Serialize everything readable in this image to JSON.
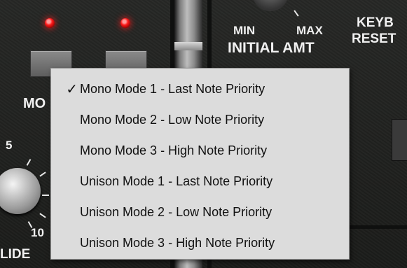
{
  "panel": {
    "labels": {
      "mo": "MO",
      "min": "MIN",
      "max": "MAX",
      "initial_amt": "INITIAL AMT",
      "keyb": "KEYB",
      "reset": "RESET",
      "five": "5",
      "ten": "10",
      "lide": "LIDE"
    },
    "led_color": "#ff1a1a"
  },
  "menu": {
    "items": [
      {
        "label": "Mono Mode 1 - Last Note Priority",
        "checked": true,
        "check_glyph": "✓"
      },
      {
        "label": "Mono Mode 2 - Low Note Priority",
        "checked": false,
        "check_glyph": ""
      },
      {
        "label": "Mono Mode 3 - High Note Priority",
        "checked": false,
        "check_glyph": ""
      },
      {
        "label": "Unison Mode 1 - Last Note Priority",
        "checked": false,
        "check_glyph": ""
      },
      {
        "label": "Unison Mode 2 - Low Note Priority",
        "checked": false,
        "check_glyph": ""
      },
      {
        "label": "Unison Mode 3 - High Note Priority",
        "checked": false,
        "check_glyph": ""
      }
    ]
  }
}
